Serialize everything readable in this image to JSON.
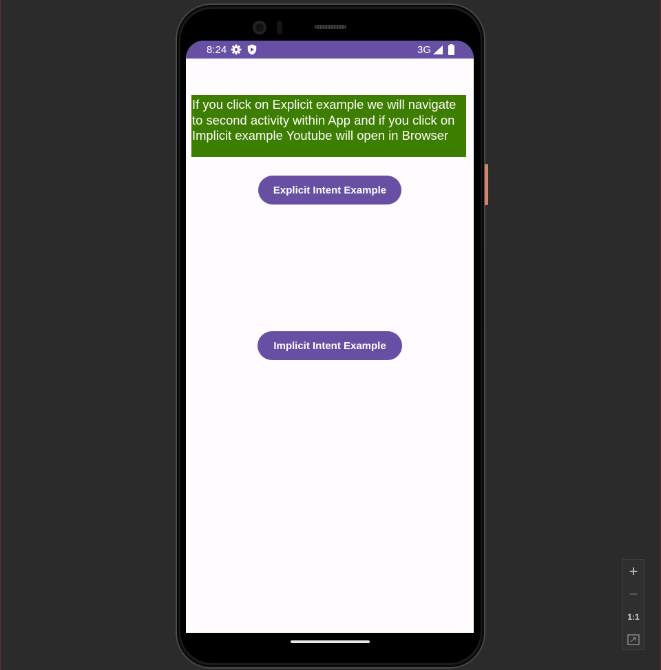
{
  "status_bar": {
    "time": "8:24",
    "network": "3G",
    "icons": [
      "gear-icon",
      "shield-icon",
      "signal-icon",
      "battery-icon"
    ]
  },
  "main": {
    "info_text": "If you click on Explicit example we will navigate to second activity within App and if you click on Implicit example Youtube will open in Browser",
    "explicit_button_label": "Explicit Intent Example",
    "implicit_button_label": "Implicit Intent Example"
  },
  "zoom_controls": {
    "zoom_in": "+",
    "zoom_out": "−",
    "actual_size": "1:1"
  },
  "colors": {
    "accent": "#6750a4",
    "info_background": "#3d7d00",
    "screen_background": "#fffbfe",
    "emulator_background": "#2b2b2b"
  }
}
